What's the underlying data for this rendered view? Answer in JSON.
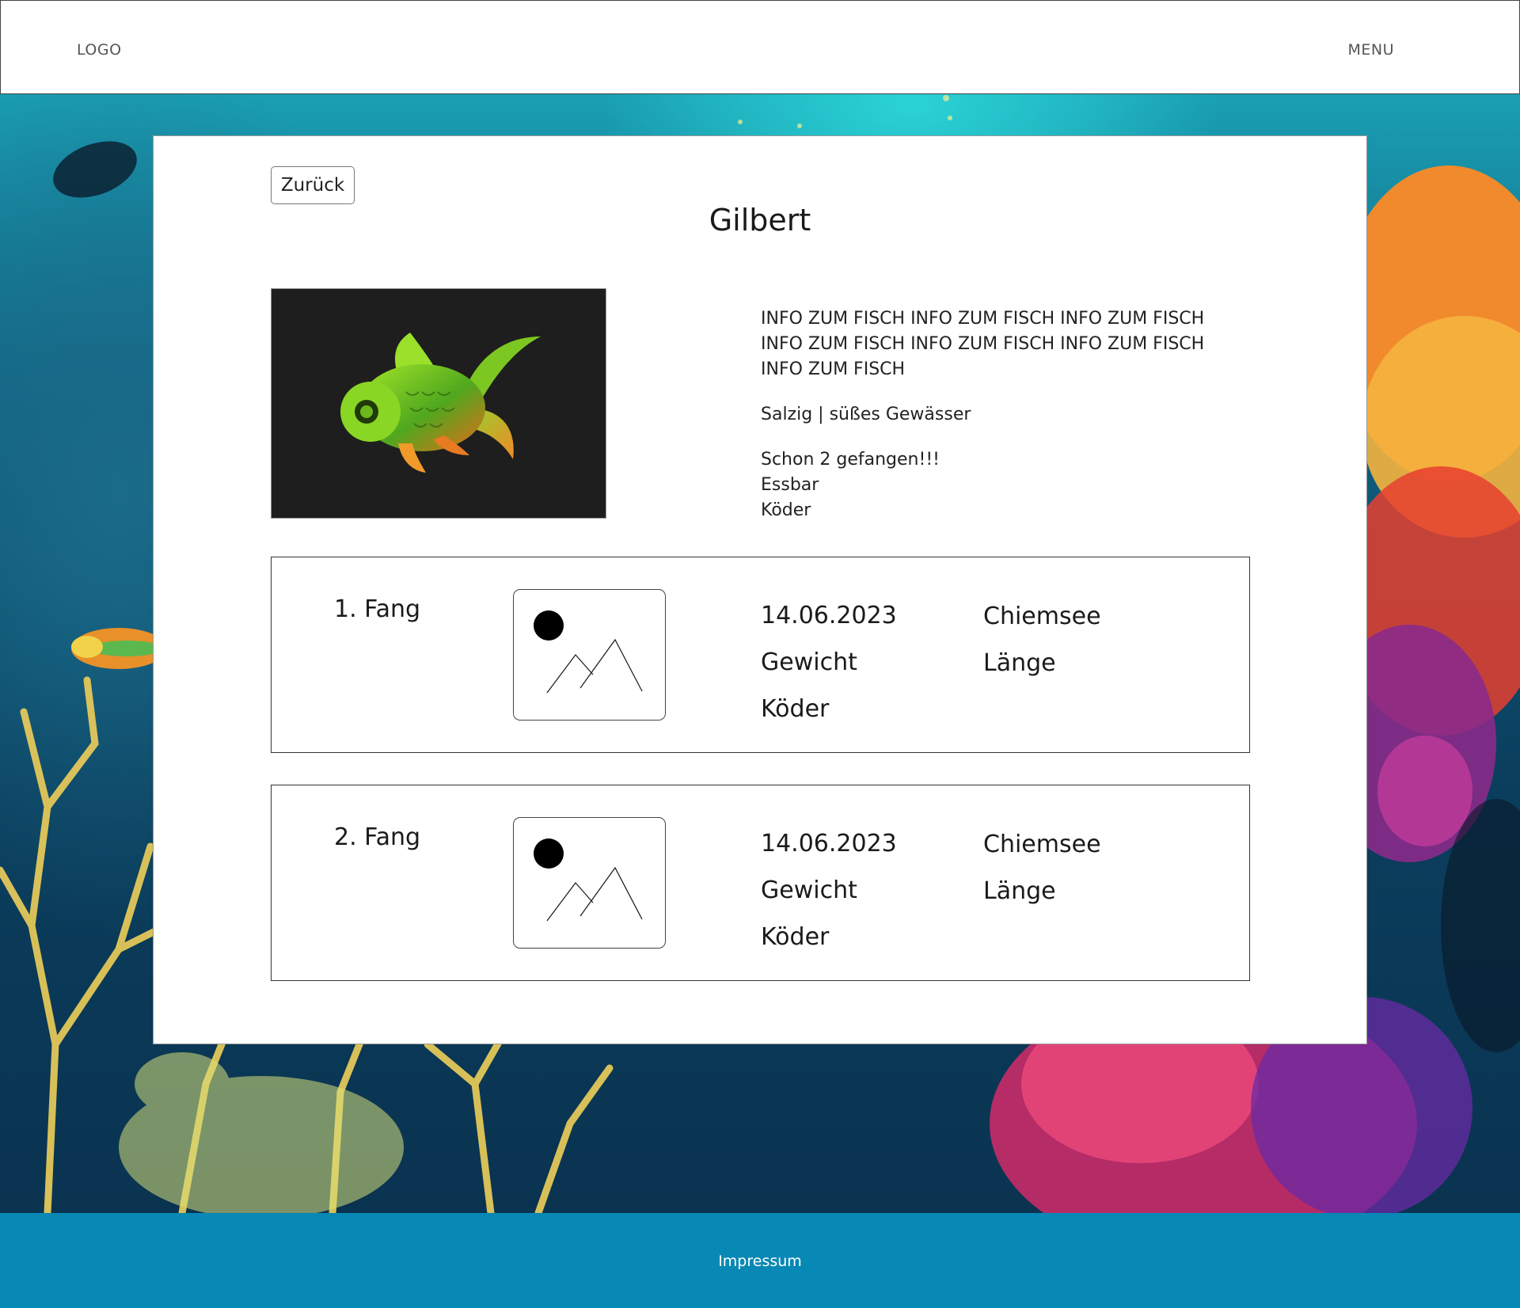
{
  "header": {
    "logo": "LOGO",
    "menu": "MENU"
  },
  "card": {
    "back_label": "Zurück",
    "title": "Gilbert",
    "info_text": "INFO ZUM FISCH INFO ZUM FISCH INFO ZUM FISCH INFO ZUM FISCH INFO ZUM FISCH INFO ZUM FISCH INFO ZUM FISCH",
    "water": "Salzig | süßes Gewässer",
    "caught_count": "Schon 2 gefangen!!!",
    "edible": "Essbar",
    "bait": "Köder"
  },
  "catches": [
    {
      "label": "1. Fang",
      "date": "14.06.2023",
      "weight": "Gewicht",
      "bait": "Köder",
      "location": "Chiemsee",
      "length": "Länge"
    },
    {
      "label": "2. Fang",
      "date": "14.06.2023",
      "weight": "Gewicht",
      "bait": "Köder",
      "location": "Chiemsee",
      "length": "Länge"
    }
  ],
  "footer": {
    "impressum": "Impressum"
  },
  "colors": {
    "footer_bg": "#0888b4",
    "fish_image_bg": "#1e1e1e"
  },
  "icons": {
    "catch_image": "image-placeholder-icon",
    "fish": "goldfish-illustration"
  }
}
